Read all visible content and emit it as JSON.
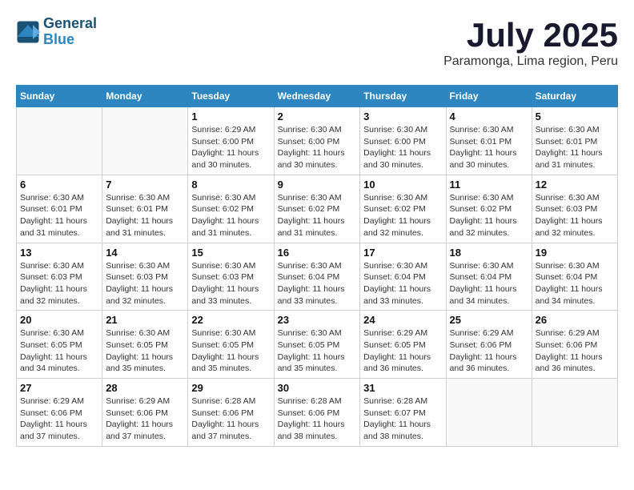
{
  "logo": {
    "line1": "General",
    "line2": "Blue"
  },
  "title": "July 2025",
  "location": "Paramonga, Lima region, Peru",
  "headers": [
    "Sunday",
    "Monday",
    "Tuesday",
    "Wednesday",
    "Thursday",
    "Friday",
    "Saturday"
  ],
  "weeks": [
    [
      {
        "day": "",
        "info": ""
      },
      {
        "day": "",
        "info": ""
      },
      {
        "day": "1",
        "info": "Sunrise: 6:29 AM\nSunset: 6:00 PM\nDaylight: 11 hours and 30 minutes."
      },
      {
        "day": "2",
        "info": "Sunrise: 6:30 AM\nSunset: 6:00 PM\nDaylight: 11 hours and 30 minutes."
      },
      {
        "day": "3",
        "info": "Sunrise: 6:30 AM\nSunset: 6:00 PM\nDaylight: 11 hours and 30 minutes."
      },
      {
        "day": "4",
        "info": "Sunrise: 6:30 AM\nSunset: 6:01 PM\nDaylight: 11 hours and 30 minutes."
      },
      {
        "day": "5",
        "info": "Sunrise: 6:30 AM\nSunset: 6:01 PM\nDaylight: 11 hours and 31 minutes."
      }
    ],
    [
      {
        "day": "6",
        "info": "Sunrise: 6:30 AM\nSunset: 6:01 PM\nDaylight: 11 hours and 31 minutes."
      },
      {
        "day": "7",
        "info": "Sunrise: 6:30 AM\nSunset: 6:01 PM\nDaylight: 11 hours and 31 minutes."
      },
      {
        "day": "8",
        "info": "Sunrise: 6:30 AM\nSunset: 6:02 PM\nDaylight: 11 hours and 31 minutes."
      },
      {
        "day": "9",
        "info": "Sunrise: 6:30 AM\nSunset: 6:02 PM\nDaylight: 11 hours and 31 minutes."
      },
      {
        "day": "10",
        "info": "Sunrise: 6:30 AM\nSunset: 6:02 PM\nDaylight: 11 hours and 32 minutes."
      },
      {
        "day": "11",
        "info": "Sunrise: 6:30 AM\nSunset: 6:02 PM\nDaylight: 11 hours and 32 minutes."
      },
      {
        "day": "12",
        "info": "Sunrise: 6:30 AM\nSunset: 6:03 PM\nDaylight: 11 hours and 32 minutes."
      }
    ],
    [
      {
        "day": "13",
        "info": "Sunrise: 6:30 AM\nSunset: 6:03 PM\nDaylight: 11 hours and 32 minutes."
      },
      {
        "day": "14",
        "info": "Sunrise: 6:30 AM\nSunset: 6:03 PM\nDaylight: 11 hours and 32 minutes."
      },
      {
        "day": "15",
        "info": "Sunrise: 6:30 AM\nSunset: 6:03 PM\nDaylight: 11 hours and 33 minutes."
      },
      {
        "day": "16",
        "info": "Sunrise: 6:30 AM\nSunset: 6:04 PM\nDaylight: 11 hours and 33 minutes."
      },
      {
        "day": "17",
        "info": "Sunrise: 6:30 AM\nSunset: 6:04 PM\nDaylight: 11 hours and 33 minutes."
      },
      {
        "day": "18",
        "info": "Sunrise: 6:30 AM\nSunset: 6:04 PM\nDaylight: 11 hours and 34 minutes."
      },
      {
        "day": "19",
        "info": "Sunrise: 6:30 AM\nSunset: 6:04 PM\nDaylight: 11 hours and 34 minutes."
      }
    ],
    [
      {
        "day": "20",
        "info": "Sunrise: 6:30 AM\nSunset: 6:05 PM\nDaylight: 11 hours and 34 minutes."
      },
      {
        "day": "21",
        "info": "Sunrise: 6:30 AM\nSunset: 6:05 PM\nDaylight: 11 hours and 35 minutes."
      },
      {
        "day": "22",
        "info": "Sunrise: 6:30 AM\nSunset: 6:05 PM\nDaylight: 11 hours and 35 minutes."
      },
      {
        "day": "23",
        "info": "Sunrise: 6:30 AM\nSunset: 6:05 PM\nDaylight: 11 hours and 35 minutes."
      },
      {
        "day": "24",
        "info": "Sunrise: 6:29 AM\nSunset: 6:05 PM\nDaylight: 11 hours and 36 minutes."
      },
      {
        "day": "25",
        "info": "Sunrise: 6:29 AM\nSunset: 6:06 PM\nDaylight: 11 hours and 36 minutes."
      },
      {
        "day": "26",
        "info": "Sunrise: 6:29 AM\nSunset: 6:06 PM\nDaylight: 11 hours and 36 minutes."
      }
    ],
    [
      {
        "day": "27",
        "info": "Sunrise: 6:29 AM\nSunset: 6:06 PM\nDaylight: 11 hours and 37 minutes."
      },
      {
        "day": "28",
        "info": "Sunrise: 6:29 AM\nSunset: 6:06 PM\nDaylight: 11 hours and 37 minutes."
      },
      {
        "day": "29",
        "info": "Sunrise: 6:28 AM\nSunset: 6:06 PM\nDaylight: 11 hours and 37 minutes."
      },
      {
        "day": "30",
        "info": "Sunrise: 6:28 AM\nSunset: 6:06 PM\nDaylight: 11 hours and 38 minutes."
      },
      {
        "day": "31",
        "info": "Sunrise: 6:28 AM\nSunset: 6:07 PM\nDaylight: 11 hours and 38 minutes."
      },
      {
        "day": "",
        "info": ""
      },
      {
        "day": "",
        "info": ""
      }
    ]
  ]
}
